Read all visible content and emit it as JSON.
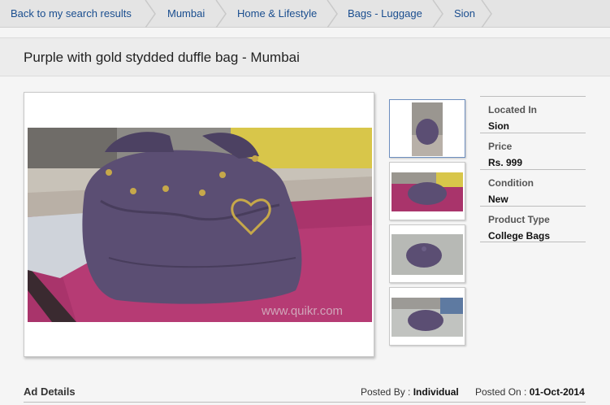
{
  "breadcrumb": {
    "back": "Back to my search results",
    "items": [
      "Mumbai",
      "Home & Lifestyle",
      "Bags - Luggage",
      "Sion"
    ]
  },
  "listing": {
    "title": "Purple with gold stydded duffle bag - Mumbai",
    "watermark": "www.quikr.com",
    "thumbnail_count": 4
  },
  "details": [
    {
      "label": "Located In",
      "value": "Sion"
    },
    {
      "label": "Price",
      "value": "Rs. 999"
    },
    {
      "label": "Condition",
      "value": "New"
    },
    {
      "label": "Product Type",
      "value": "College Bags"
    }
  ],
  "ad_details": {
    "heading": "Ad Details",
    "posted_by_label": "Posted By :",
    "posted_by": "Individual",
    "posted_on_label": "Posted On :",
    "posted_on": "01-Oct-2014"
  },
  "colors": {
    "link": "#1a4e8f",
    "bag_purple": "#5b4e73",
    "carpet_magenta": "#a9346b"
  }
}
